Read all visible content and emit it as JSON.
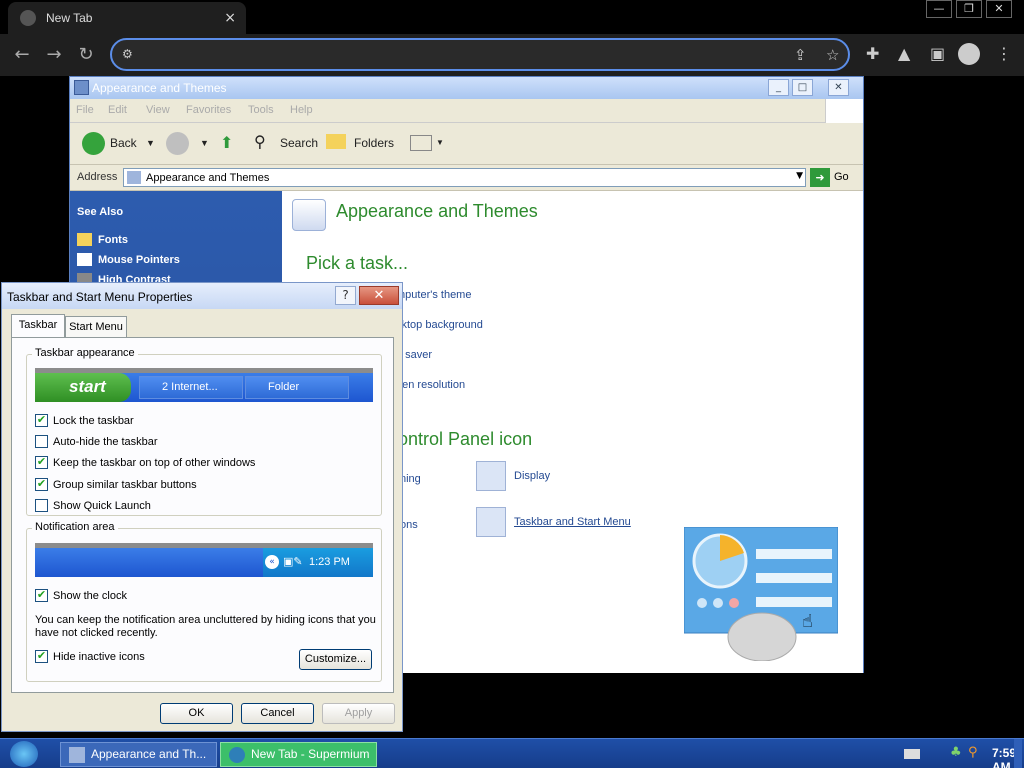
{
  "browser": {
    "tab_title": "New Tab",
    "tab_close": "×",
    "address_value": "",
    "window_controls": [
      "—",
      "❐",
      "✕"
    ]
  },
  "explorer": {
    "title": "Appearance and Themes",
    "menu": [
      "File",
      "Edit",
      "View",
      "Favorites",
      "Tools",
      "Help"
    ],
    "toolbar": {
      "back": "Back",
      "search": "Search",
      "folders": "Folders"
    },
    "address_label": "Address",
    "address_value": "Appearance and Themes",
    "go_label": "Go",
    "see_also": {
      "heading": "See Also",
      "items": [
        "Fonts",
        "Mouse Pointers",
        "High Contrast"
      ]
    },
    "heading": "Appearance and Themes",
    "pick_task": "Pick a task...",
    "tasks": [
      "mputer's theme",
      "sktop background",
      "n saver",
      "een resolution"
    ],
    "cp_heading": "ontrol Panel icon",
    "cp_items_left": [
      "ning",
      "ons"
    ],
    "cp_items": [
      "Display",
      "Taskbar and Start Menu"
    ]
  },
  "dialog": {
    "title": "Taskbar and Start Menu Properties",
    "help_label": "?",
    "close_label": "✕",
    "tabs": [
      "Taskbar",
      "Start Menu"
    ],
    "taskbar_appearance": {
      "label": "Taskbar appearance",
      "start_label": "start",
      "task_buttons": [
        "2 Internet...",
        "Folder"
      ],
      "options": [
        {
          "label": "Lock the taskbar",
          "checked": true
        },
        {
          "label": "Auto-hide the taskbar",
          "checked": false
        },
        {
          "label": "Keep the taskbar on top of other windows",
          "checked": true
        },
        {
          "label": "Group similar taskbar buttons",
          "checked": true
        },
        {
          "label": "Show Quick Launch",
          "checked": false
        }
      ]
    },
    "notification_area": {
      "label": "Notification area",
      "preview_clock": "1:23 PM",
      "show_clock": {
        "label": "Show the clock",
        "checked": true
      },
      "hint": "You can keep the notification area uncluttered by hiding icons that you have not clicked recently.",
      "hide_inactive": {
        "label": "Hide inactive icons",
        "checked": true
      },
      "customize_label": "Customize..."
    },
    "buttons": {
      "ok": "OK",
      "cancel": "Cancel",
      "apply": "Apply"
    }
  },
  "taskbar": {
    "items": [
      "Appearance and Th...",
      "New Tab - Supermium"
    ],
    "clock": "7:59 AM"
  },
  "colors": {
    "xp_green_heading": "#2e8b2e",
    "xp_link": "#244a92",
    "omnibox_border": "#5b8de8",
    "taskbar_blue": "#1f4fa8"
  }
}
